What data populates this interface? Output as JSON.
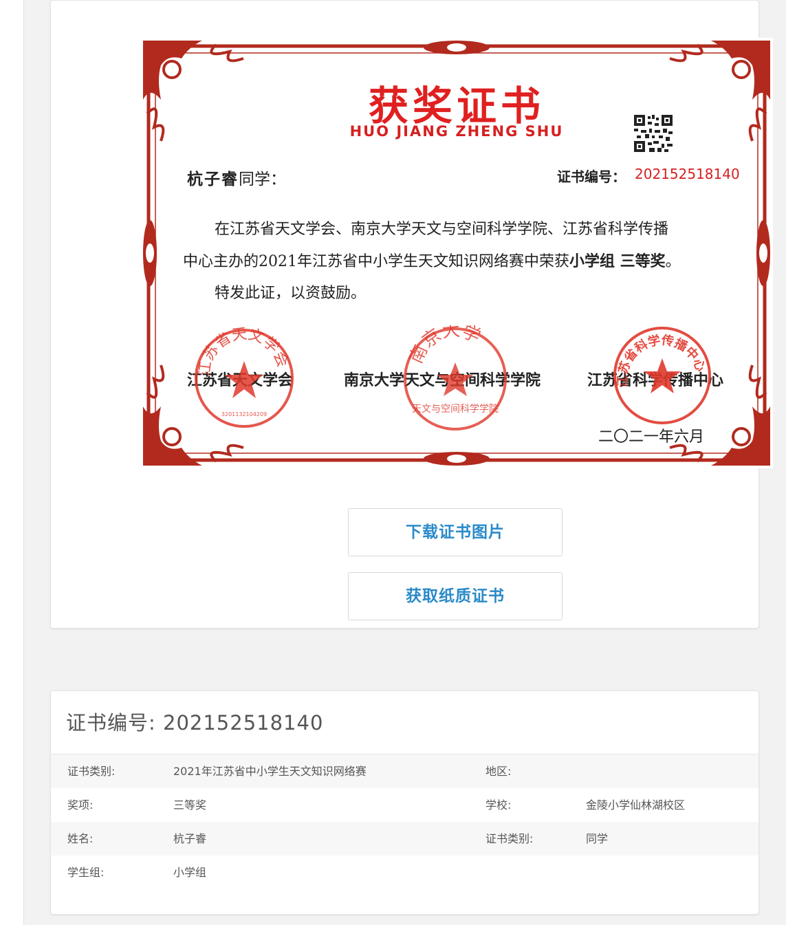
{
  "certificate": {
    "title_cn": "获奖证书",
    "title_en": "HUO JIANG ZHENG SHU",
    "recipient_name": "杭子睿",
    "recipient_suffix": "同学：",
    "certno_label": "证书编号：",
    "certno_value": "202152518140",
    "body_line1": "在江苏省天文学会、南京大学天文与空间科学学院、江苏省科学传播",
    "body_line2_pre": "中心主办的2021年江苏省中小学生天文知识网络赛中荣获",
    "body_line2_award": "小学组 三等奖",
    "body_line2_end": "。",
    "body_line3": "特发此证，以资鼓励。",
    "org1": "江苏省天文学会",
    "org2": "南京大学天文与空间科学学院",
    "org3": "江苏省科学传播中心",
    "date": "二〇二一年六月",
    "seal1_text": "江苏省天文学会",
    "seal1_number": "3201132104209",
    "seal2_text": "南京大学",
    "seal2_sub": "天文与空间科学学院",
    "seal3_text": "江苏省科学传播中心",
    "colors": {
      "red": "#d62020",
      "frame": "#b22a1e",
      "seal": "#e0382c"
    }
  },
  "buttons": {
    "download_label": "下载证书图片",
    "paper_label": "获取纸质证书",
    "accent": "#2a8ac9"
  },
  "info": {
    "header_label": "证书编号: ",
    "header_value": "202152518140",
    "rows": [
      {
        "k1": "证书类别:",
        "v1": "2021年江苏省中小学生天文知识网络赛",
        "k2": "地区:",
        "v2": ""
      },
      {
        "k1": "奖项:",
        "v1": "三等奖",
        "k2": "学校:",
        "v2": "金陵小学仙林湖校区"
      },
      {
        "k1": "姓名:",
        "v1": "杭子睿",
        "k2": "证书类别:",
        "v2": "同学"
      },
      {
        "k1": "学生组:",
        "v1": "小学组",
        "k2": "",
        "v2": ""
      }
    ]
  }
}
